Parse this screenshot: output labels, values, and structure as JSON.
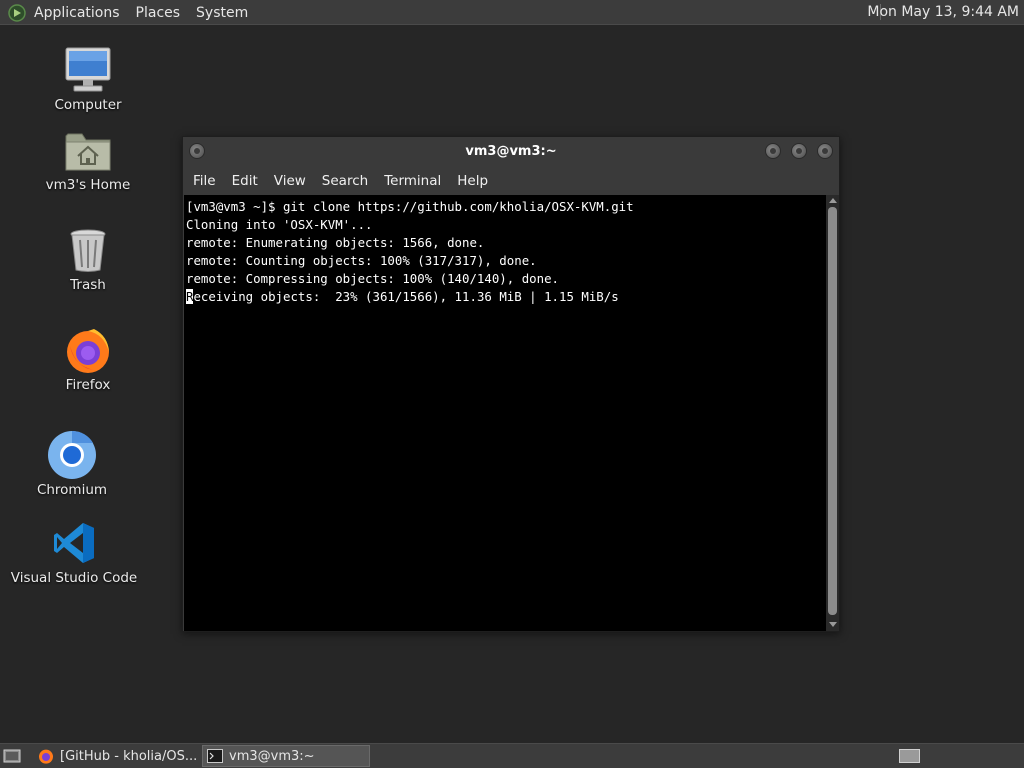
{
  "top_panel": {
    "menus": [
      "Applications",
      "Places",
      "System"
    ],
    "clock": "Mon May 13,  9:44 AM"
  },
  "desktop_icons": [
    {
      "label": "Computer",
      "icon": "computer-icon"
    },
    {
      "label": "vm3's Home",
      "icon": "home-folder-icon"
    },
    {
      "label": "Trash",
      "icon": "trash-icon"
    },
    {
      "label": "Firefox",
      "icon": "firefox-icon"
    },
    {
      "label": "Chromium",
      "icon": "chromium-icon"
    },
    {
      "label": "Visual Studio Code",
      "icon": "vscode-icon"
    }
  ],
  "terminal": {
    "title": "vm3@vm3:~",
    "menu": [
      "File",
      "Edit",
      "View",
      "Search",
      "Terminal",
      "Help"
    ],
    "lines": [
      "[vm3@vm3 ~]$ git clone https://github.com/kholia/OSX-KVM.git",
      "Cloning into 'OSX-KVM'...",
      "remote: Enumerating objects: 1566, done.",
      "remote: Counting objects: 100% (317/317), done.",
      "remote: Compressing objects: 100% (140/140), done."
    ],
    "cursor_line": {
      "cursor_char": "R",
      "rest": "eceiving objects:  23% (361/1566), 11.36 MiB | 1.15 MiB/s"
    }
  },
  "taskbar": {
    "tasks": [
      {
        "label": "[GitHub - kholia/OS...",
        "icon": "firefox-icon",
        "active": false
      },
      {
        "label": "vm3@vm3:~",
        "icon": "terminal-icon",
        "active": true
      }
    ]
  },
  "colors": {
    "desktop_bg": "#262626",
    "panel_bg": "#3c3c3c",
    "terminal_bg": "#000000",
    "terminal_text": "#ffffff"
  }
}
